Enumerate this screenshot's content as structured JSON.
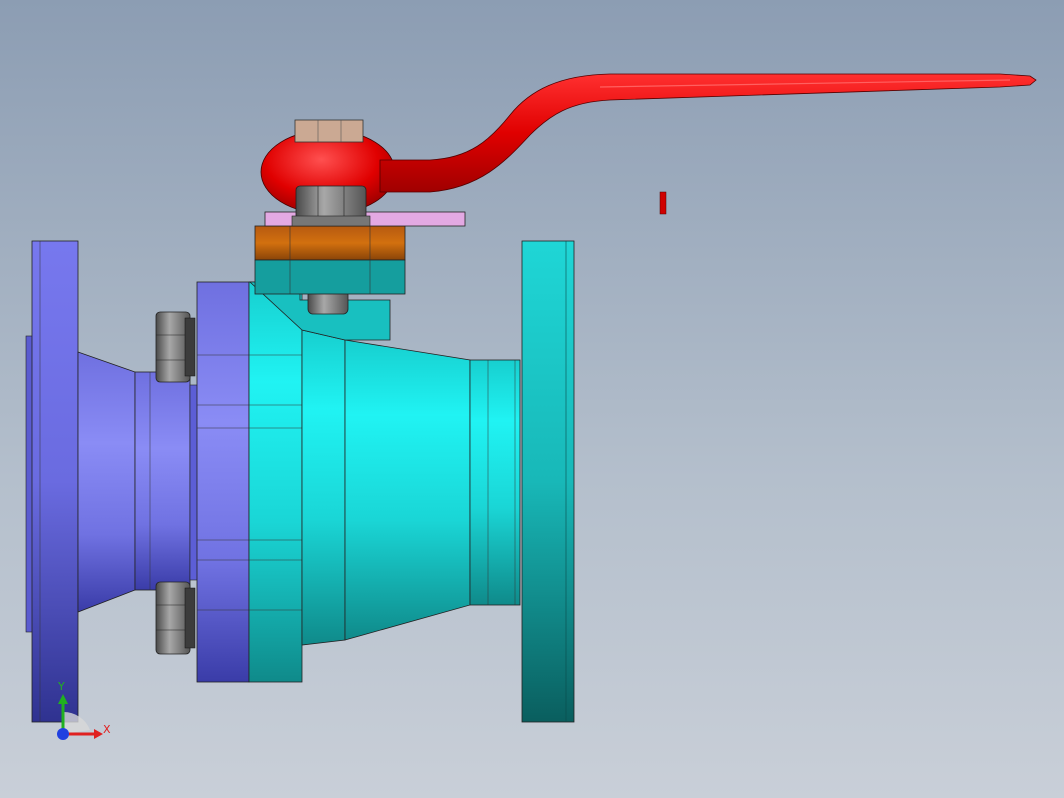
{
  "viewport": {
    "background_top": "#8c9db3",
    "background_bottom": "#c9cfd8"
  },
  "model": {
    "name": "",
    "parts": [
      {
        "name": "left-flange",
        "color": "#6f70e6"
      },
      {
        "name": "left-body",
        "color": "#7a7be8"
      },
      {
        "name": "right-body",
        "color": "#1fe8e8"
      },
      {
        "name": "right-flange",
        "color": "#1bcfcf"
      },
      {
        "name": "gland-bonnet",
        "color": "#c8690e"
      },
      {
        "name": "stem-nut",
        "color": "#7f7f7f"
      },
      {
        "name": "lever-handle",
        "color": "#e00000"
      },
      {
        "name": "stop-plate",
        "color": "#e0a8e0"
      },
      {
        "name": "top-nut",
        "color": "#c9a88f"
      }
    ]
  },
  "triad": {
    "x_label": "X",
    "y_label": "Y",
    "x_color": "#e02020",
    "y_color": "#20b020",
    "z_color": "#2040e0"
  }
}
